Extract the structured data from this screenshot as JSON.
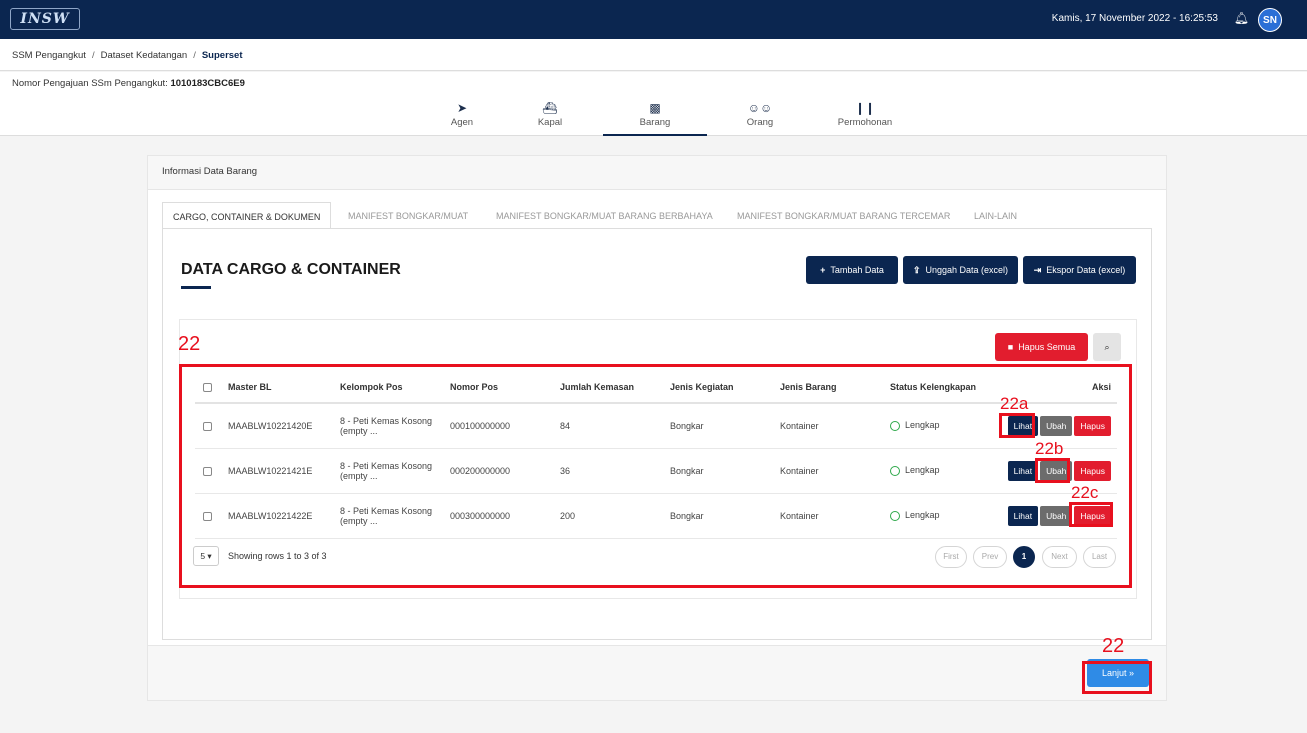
{
  "topbar": {
    "logo_text": "INSW",
    "datetime": "Kamis, 17 November 2022 - 16:25:53",
    "avatar_initials": "SN"
  },
  "breadcrumb": [
    "SSM Pengangkut",
    "Dataset Kedatangan",
    "Superset"
  ],
  "nomor": {
    "label": "Nomor Pengajuan SSm Pengangkut:",
    "value": "1010183CBC6E9"
  },
  "nav_tabs": [
    {
      "label": "Agen",
      "icon": "paper-plane-icon"
    },
    {
      "label": "Kapal",
      "icon": "ship-icon"
    },
    {
      "label": "Barang",
      "icon": "cargo-icon"
    },
    {
      "label": "Orang",
      "icon": "users-icon"
    },
    {
      "label": "Permohonan",
      "icon": "documents-icon"
    }
  ],
  "card": {
    "header": "Informasi Data Barang",
    "sub_tabs": [
      "CARGO, CONTAINER & DOKUMEN",
      "MANIFEST BONGKAR/MUAT",
      "MANIFEST BONGKAR/MUAT BARANG BERBAHAYA",
      "MANIFEST BONGKAR/MUAT BARANG TERCEMAR",
      "LAIN-LAIN"
    ],
    "section_title": "DATA CARGO & CONTAINER",
    "buttons": {
      "tambah": "Tambah Data",
      "unggah": "Unggah Data (excel)",
      "ekspor": "Ekspor Data (excel)",
      "hapus_semua": "Hapus Semua"
    },
    "next_button": "Lanjut »"
  },
  "table": {
    "columns": [
      "Master BL",
      "Kelompok Pos",
      "Nomor Pos",
      "Jumlah Kemasan",
      "Jenis Kegiatan",
      "Jenis Barang",
      "Status Kelengkapan",
      "Aksi"
    ],
    "rows": [
      {
        "master_bl": "MAABLW10221420E",
        "kelompok_pos": "8 - Peti Kemas Kosong (empty ...",
        "nomor_pos": "000100000000",
        "jumlah": "84",
        "kegiatan": "Bongkar",
        "barang": "Kontainer",
        "status": "Lengkap"
      },
      {
        "master_bl": "MAABLW10221421E",
        "kelompok_pos": "8 - Peti Kemas Kosong (empty ...",
        "nomor_pos": "000200000000",
        "jumlah": "36",
        "kegiatan": "Bongkar",
        "barang": "Kontainer",
        "status": "Lengkap"
      },
      {
        "master_bl": "MAABLW10221422E",
        "kelompok_pos": "8 - Peti Kemas Kosong (empty ...",
        "nomor_pos": "000300000000",
        "jumlah": "200",
        "kegiatan": "Bongkar",
        "barang": "Kontainer",
        "status": "Lengkap"
      }
    ],
    "actions": {
      "lihat": "Lihat",
      "ubah": "Ubah",
      "hapus": "Hapus"
    }
  },
  "pagination": {
    "page_size": "5 ▾",
    "info": "Showing rows 1 to 3 of 3",
    "first": "First",
    "prev": "Prev",
    "current": "1",
    "next": "Next",
    "last": "Last"
  },
  "annotations": {
    "table": "22",
    "lihat": "22a",
    "ubah": "22b",
    "hapus": "22c",
    "lanjut": "22"
  },
  "colors": {
    "navy": "#0b2650",
    "red": "#e21d2e",
    "annotation": "#e8101e",
    "status_green": "#2ea84a"
  }
}
